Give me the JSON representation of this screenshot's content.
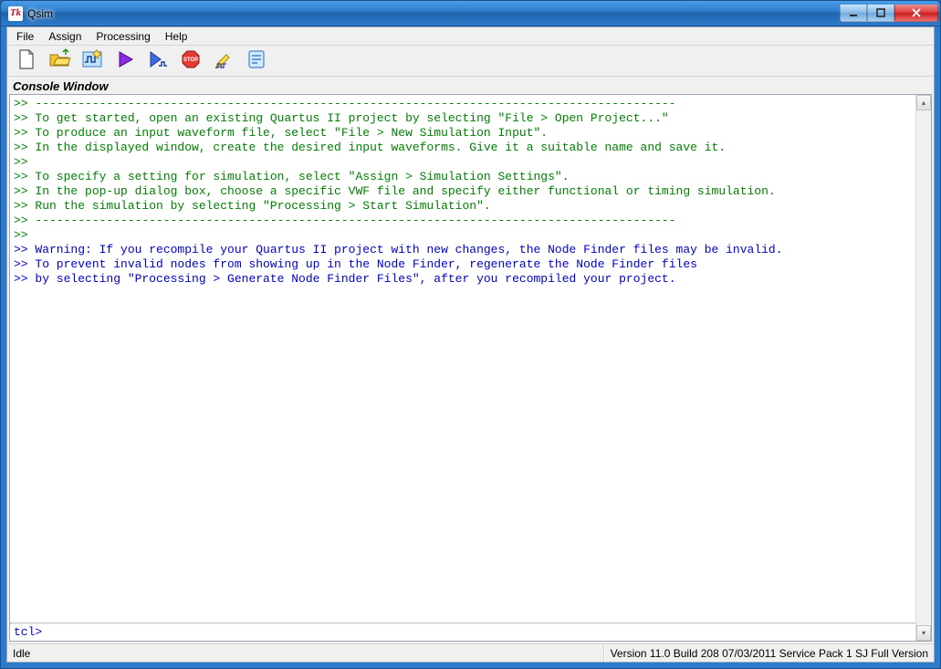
{
  "window": {
    "title": "Qsim",
    "icon_label": "Tk"
  },
  "menu": {
    "items": [
      "File",
      "Assign",
      "Processing",
      "Help"
    ]
  },
  "toolbar": {
    "buttons": [
      {
        "name": "new-file",
        "title": "New"
      },
      {
        "name": "open-file",
        "title": "Open"
      },
      {
        "name": "waveform-editor",
        "title": "Waveform Editor"
      },
      {
        "name": "run",
        "title": "Run"
      },
      {
        "name": "run-step",
        "title": "Run Step"
      },
      {
        "name": "stop",
        "title": "Stop"
      },
      {
        "name": "edit",
        "title": "Edit"
      },
      {
        "name": "report",
        "title": "Report"
      }
    ]
  },
  "console": {
    "title": "Console Window",
    "lines": [
      {
        "cls": "c-green",
        "text": ">> ------------------------------------------------------------------------------------------"
      },
      {
        "cls": "c-green",
        "text": ">> To get started, open an existing Quartus II project by selecting \"File > Open Project...\""
      },
      {
        "cls": "c-green",
        "text": ">> To produce an input waveform file, select \"File > New Simulation Input\"."
      },
      {
        "cls": "c-green",
        "text": ">> In the displayed window, create the desired input waveforms. Give it a suitable name and save it."
      },
      {
        "cls": "c-green",
        "text": ">>"
      },
      {
        "cls": "c-green",
        "text": ">> To specify a setting for simulation, select \"Assign > Simulation Settings\"."
      },
      {
        "cls": "c-green",
        "text": ">> In the pop-up dialog box, choose a specific VWF file and specify either functional or timing simulation."
      },
      {
        "cls": "c-green",
        "text": ">> Run the simulation by selecting \"Processing > Start Simulation\"."
      },
      {
        "cls": "c-green",
        "text": ">> ------------------------------------------------------------------------------------------"
      },
      {
        "cls": "c-green",
        "text": ">>"
      },
      {
        "cls": "c-blue",
        "text": ">> Warning: If you recompile your Quartus II project with new changes, the Node Finder files may be invalid."
      },
      {
        "cls": "c-blue",
        "text": ">> To prevent invalid nodes from showing up in the Node Finder, regenerate the Node Finder files"
      },
      {
        "cls": "c-blue",
        "text": ">> by selecting \"Processing > Generate Node Finder Files\", after you recompiled your project."
      }
    ],
    "prompt": "tcl>",
    "input_value": ""
  },
  "status": {
    "left": "Idle",
    "right": "Version 11.0 Build 208 07/03/2011 Service Pack 1 SJ Full Version"
  }
}
